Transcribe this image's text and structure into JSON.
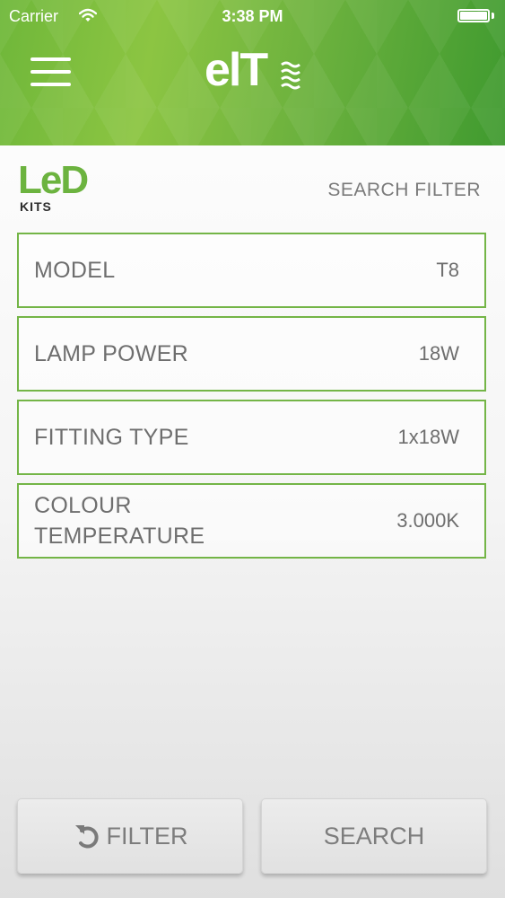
{
  "status_bar": {
    "carrier": "Carrier",
    "time": "3:38 PM",
    "battery_level": 1.0
  },
  "header": {
    "logo": "elt",
    "brand_color": "#6cb33f"
  },
  "product_logo": {
    "word": "LeD",
    "sub": "KITS"
  },
  "section_title": "SEARCH FILTER",
  "filters": [
    {
      "label": "MODEL",
      "value": "T8"
    },
    {
      "label": "LAMP POWER",
      "value": "18W"
    },
    {
      "label": "FITTING TYPE",
      "value": "1x18W"
    },
    {
      "label": "COLOUR TEMPERATURE",
      "value": "3.000K"
    }
  ],
  "buttons": {
    "filter_reset": "FILTER",
    "search": "SEARCH"
  },
  "icons": {
    "menu": "hamburger-menu-icon",
    "wifi": "wifi-icon",
    "battery": "battery-icon",
    "reset": "reset-icon"
  }
}
